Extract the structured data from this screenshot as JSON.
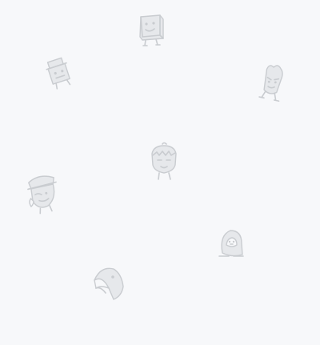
{
  "background_color": "#f7f8fa",
  "doodle_color": "#c9ccd0",
  "doodles": [
    {
      "icon": "box-character-icon"
    },
    {
      "icon": "hat-character-icon"
    },
    {
      "icon": "tall-creature-icon"
    },
    {
      "icon": "girl-face-icon"
    },
    {
      "icon": "sailor-face-icon"
    },
    {
      "icon": "penguin-blob-icon"
    },
    {
      "icon": "toucan-beak-icon"
    }
  ]
}
